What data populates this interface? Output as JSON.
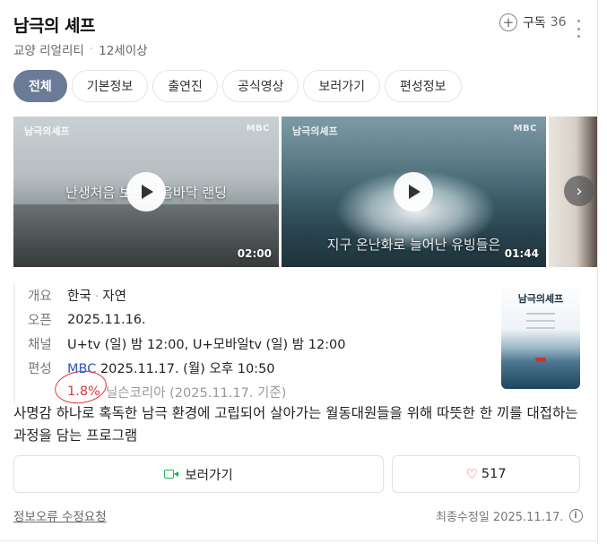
{
  "header": {
    "title": "남극의 셰프",
    "genre": "교양 리얼리티",
    "age": "12세이상",
    "subscribe_label": "구독",
    "subscribe_count": "36"
  },
  "tabs": [
    {
      "label": "전체",
      "active": true
    },
    {
      "label": "기본정보"
    },
    {
      "label": "출연진"
    },
    {
      "label": "공식영상"
    },
    {
      "label": "보러가기"
    },
    {
      "label": "편성정보"
    }
  ],
  "videos": [
    {
      "channel_logo": "남극의셰프",
      "broadcaster": "MBC",
      "caption": "난생처음 보는 얼음바닥 랜딩",
      "duration": "02:00"
    },
    {
      "channel_logo": "남극의셰프",
      "broadcaster": "MBC",
      "caption": "지구 온난화로 늘어난 유빙들은",
      "duration": "01:44"
    }
  ],
  "info": {
    "overview_label": "개요",
    "overview_country": "한국",
    "overview_genre": "자연",
    "open_label": "오픈",
    "open_value": "2025.11.16.",
    "channel_label": "채널",
    "channel_value": "U+tv (일) 밤 12:00, U+모바일tv (일) 밤 12:00",
    "schedule_label": "편성",
    "schedule_channel": "MBC",
    "schedule_value": "2025.11.17. (월) 오후 10:50",
    "rating_value": "1.8%",
    "rating_source": "닐슨코리아 (2025.11.17. 기준)"
  },
  "poster": {
    "title": "남극의셰프"
  },
  "description": "사명감 하나로 혹독한 남극 환경에 고립되어 살아가는 월동대원들을 위해 따뜻한 한 끼를 대접하는 과정을 담는 프로그램",
  "actions": {
    "watch_label": "보러가기",
    "like_count": "517"
  },
  "footer": {
    "report_label": "정보오류 수정요청",
    "updated_label": "최종수정일 2025.11.17."
  },
  "colors": {
    "active_tab": "#6b7a96",
    "link": "#2e55b8",
    "rating": "#d83a3a",
    "heart": "#e5484d",
    "watch_icon": "#20b557"
  }
}
